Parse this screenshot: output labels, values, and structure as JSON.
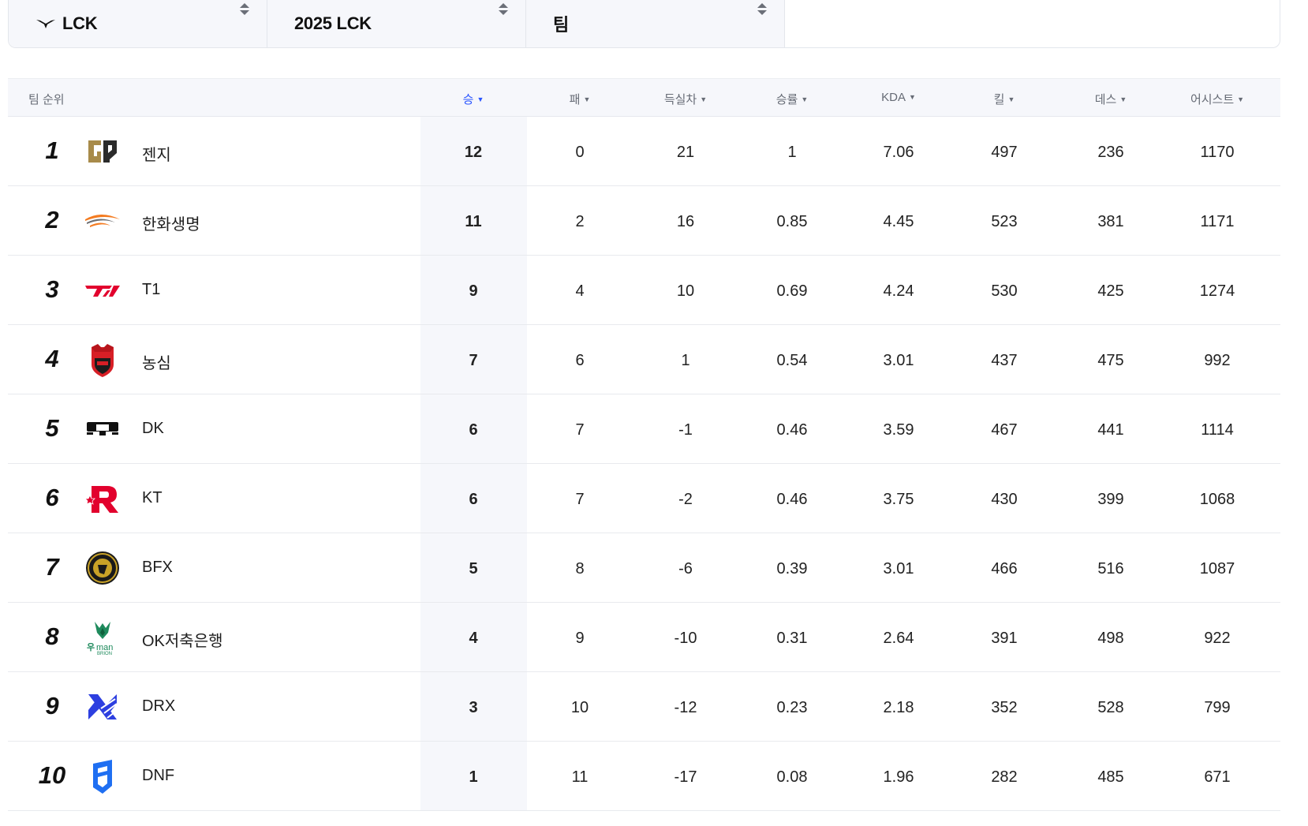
{
  "filters": {
    "league": "LCK",
    "season": "2025 LCK",
    "category": "팀"
  },
  "table": {
    "headers": {
      "rank_team": "팀 순위",
      "wins": "승",
      "losses": "패",
      "goal_diff": "득실차",
      "win_rate": "승률",
      "kda": "KDA",
      "kills": "킬",
      "deaths": "데스",
      "assists": "어시스트"
    },
    "sort_caret": "▼",
    "active_sort": "wins",
    "accent_color": "#2a55ff",
    "rows": [
      {
        "rank": "1",
        "team": "젠지",
        "logo": "geng-logo",
        "wins": "12",
        "losses": "0",
        "goal_diff": "21",
        "win_rate": "1",
        "kda": "7.06",
        "kills": "497",
        "deaths": "236",
        "assists": "1170"
      },
      {
        "rank": "2",
        "team": "한화생명",
        "logo": "hanwha-logo",
        "wins": "11",
        "losses": "2",
        "goal_diff": "16",
        "win_rate": "0.85",
        "kda": "4.45",
        "kills": "523",
        "deaths": "381",
        "assists": "1171"
      },
      {
        "rank": "3",
        "team": "T1",
        "logo": "t1-logo",
        "wins": "9",
        "losses": "4",
        "goal_diff": "10",
        "win_rate": "0.69",
        "kda": "4.24",
        "kills": "530",
        "deaths": "425",
        "assists": "1274"
      },
      {
        "rank": "4",
        "team": "농심",
        "logo": "nongshim-logo",
        "wins": "7",
        "losses": "6",
        "goal_diff": "1",
        "win_rate": "0.54",
        "kda": "3.01",
        "kills": "437",
        "deaths": "475",
        "assists": "992"
      },
      {
        "rank": "5",
        "team": "DK",
        "logo": "dk-logo",
        "wins": "6",
        "losses": "7",
        "goal_diff": "-1",
        "win_rate": "0.46",
        "kda": "3.59",
        "kills": "467",
        "deaths": "441",
        "assists": "1114"
      },
      {
        "rank": "6",
        "team": "KT",
        "logo": "kt-logo",
        "wins": "6",
        "losses": "7",
        "goal_diff": "-2",
        "win_rate": "0.46",
        "kda": "3.75",
        "kills": "430",
        "deaths": "399",
        "assists": "1068"
      },
      {
        "rank": "7",
        "team": "BFX",
        "logo": "bfx-logo",
        "wins": "5",
        "losses": "8",
        "goal_diff": "-6",
        "win_rate": "0.39",
        "kda": "3.01",
        "kills": "466",
        "deaths": "516",
        "assists": "1087"
      },
      {
        "rank": "8",
        "team": "OK저축은행",
        "logo": "brion-logo",
        "logo_text": "man",
        "logo_subtext": "BRION",
        "wins": "4",
        "losses": "9",
        "goal_diff": "-10",
        "win_rate": "0.31",
        "kda": "2.64",
        "kills": "391",
        "deaths": "498",
        "assists": "922"
      },
      {
        "rank": "9",
        "team": "DRX",
        "logo": "drx-logo",
        "wins": "3",
        "losses": "10",
        "goal_diff": "-12",
        "win_rate": "0.23",
        "kda": "2.18",
        "kills": "352",
        "deaths": "528",
        "assists": "799"
      },
      {
        "rank": "10",
        "team": "DNF",
        "logo": "dnf-logo",
        "wins": "1",
        "losses": "11",
        "goal_diff": "-17",
        "win_rate": "0.08",
        "kda": "1.96",
        "kills": "282",
        "deaths": "485",
        "assists": "671"
      }
    ]
  }
}
